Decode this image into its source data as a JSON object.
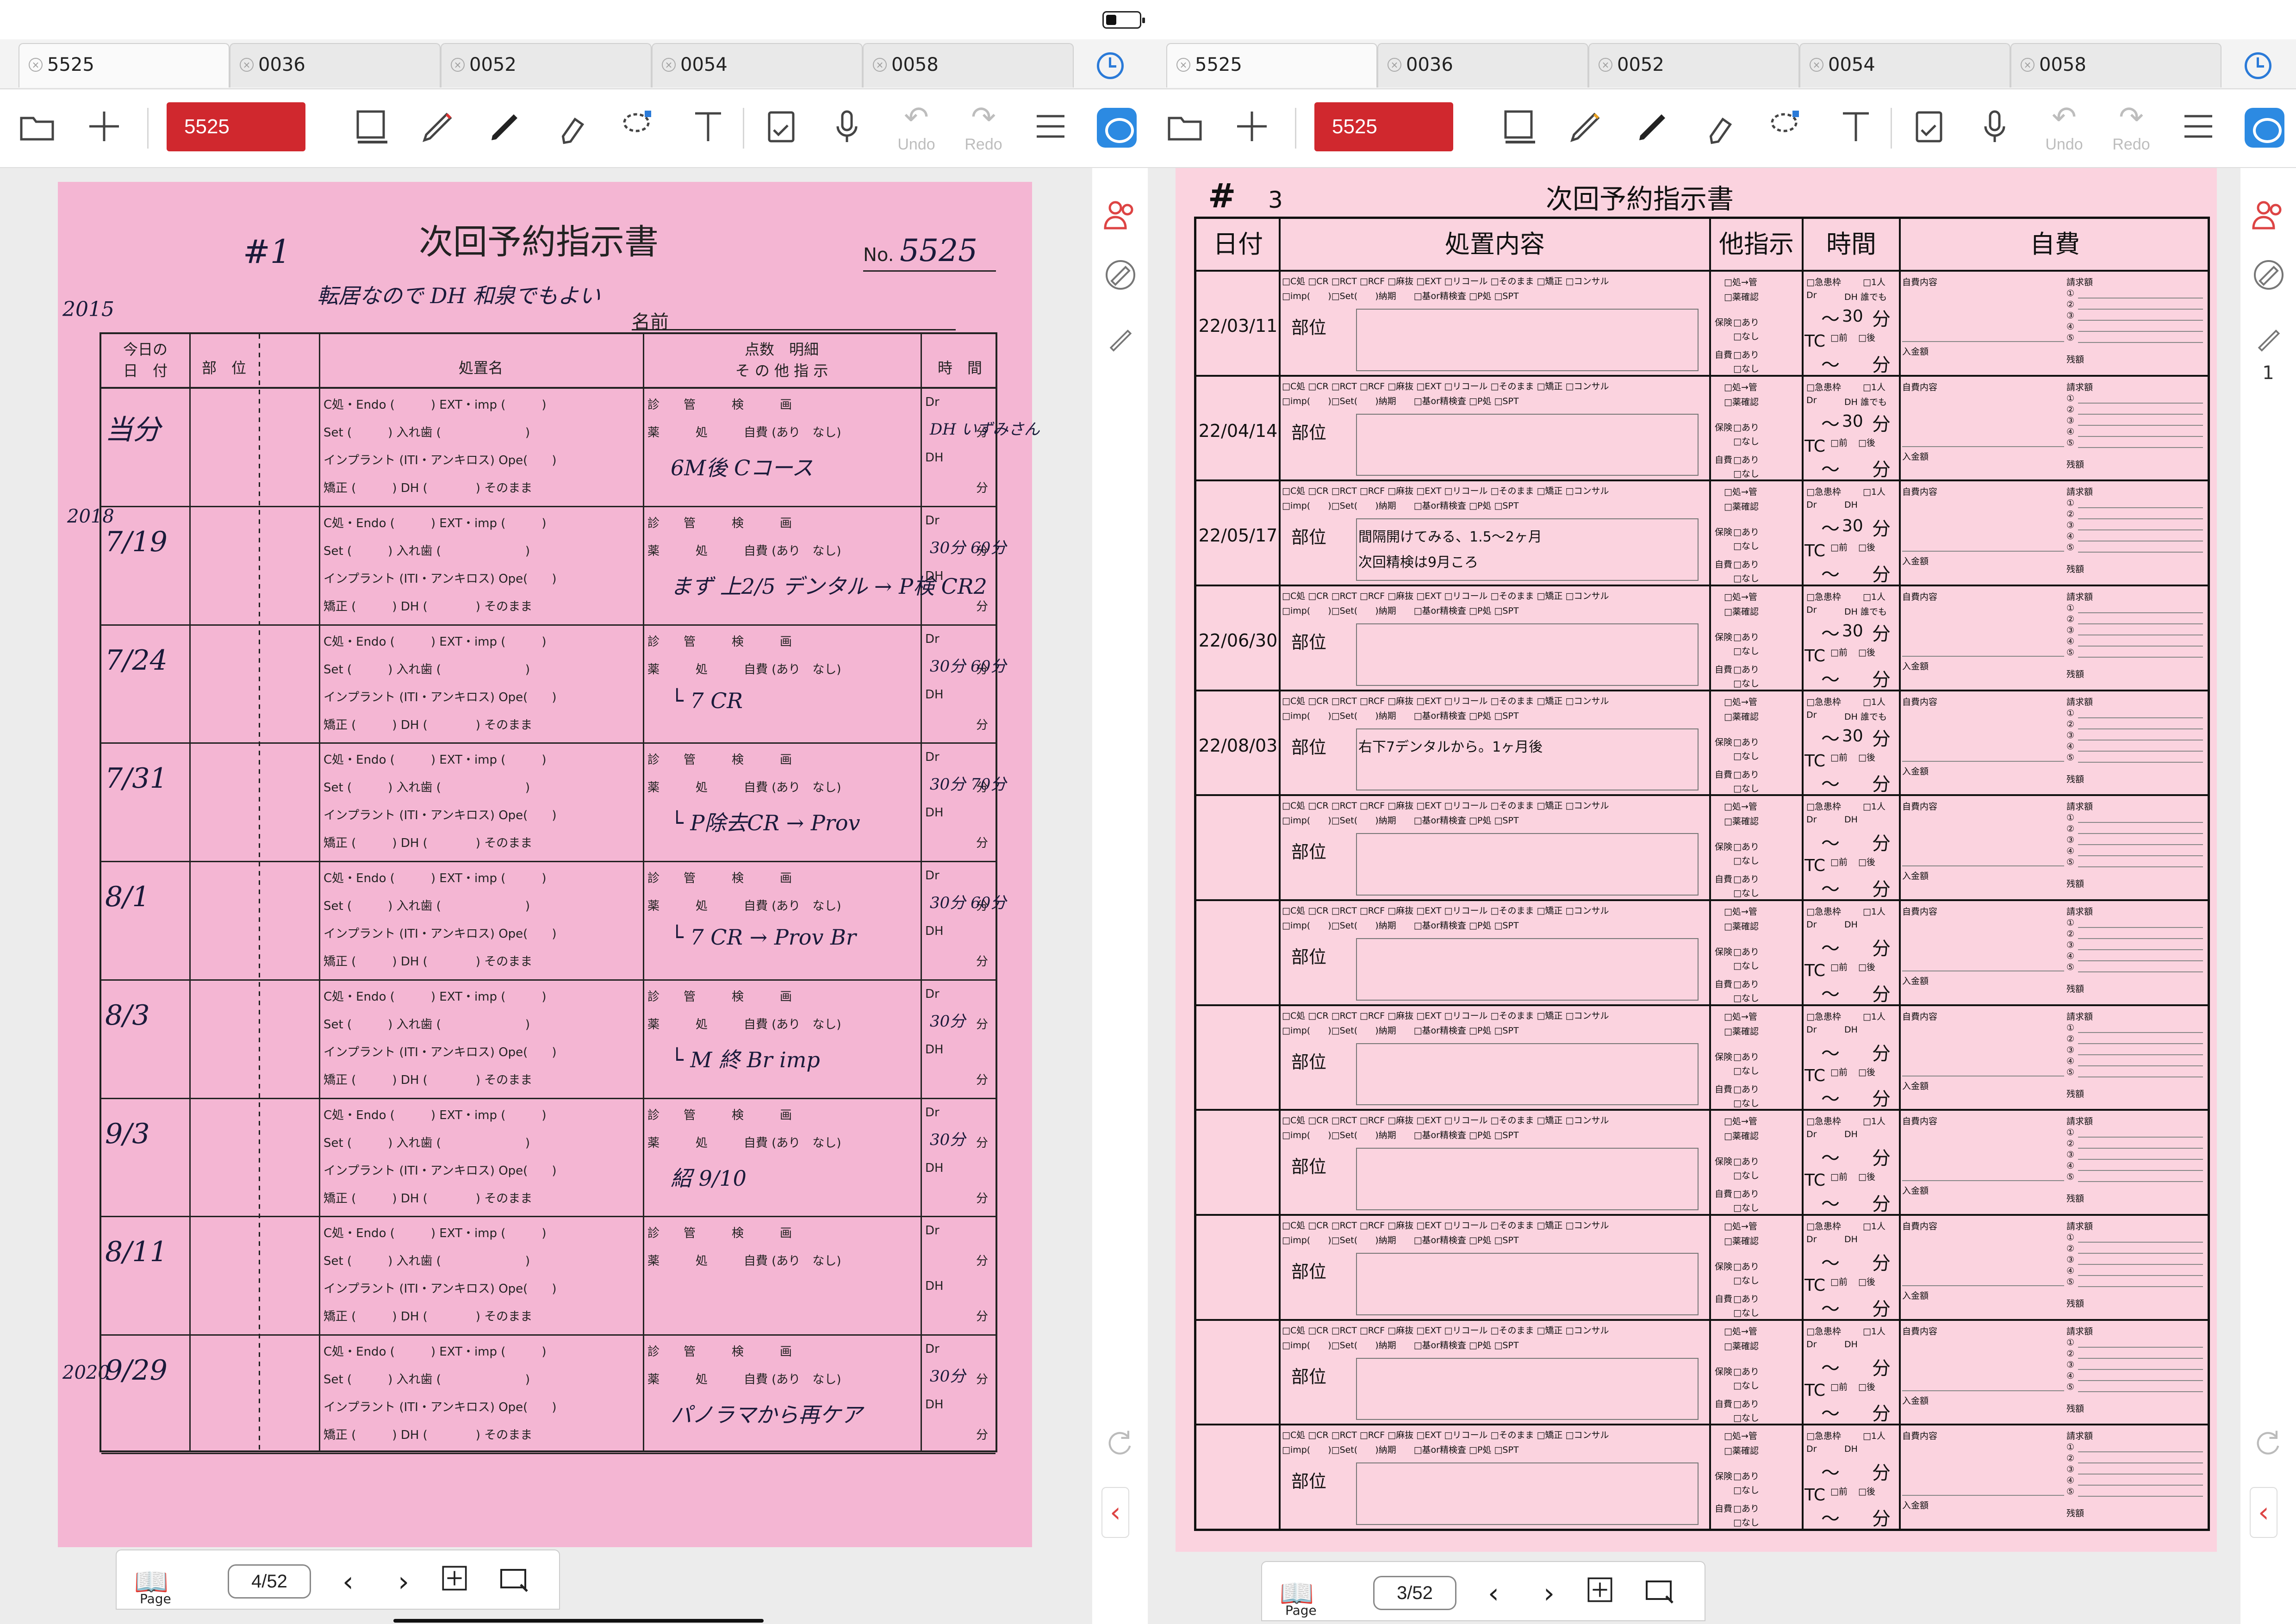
{
  "left_pane": {
    "tabs": [
      "5525",
      "0036",
      "0052",
      "0054",
      "0058"
    ],
    "toolbar": {
      "patient_name": "5525",
      "undo_label": "Undo",
      "redo_label": "Redo"
    },
    "side": {
      "page_count": ""
    },
    "bottom": {
      "page_indicator": "4/52",
      "page_label": "Page"
    },
    "form": {
      "title": "次回予約指示書",
      "no_label": "No.",
      "no_value": "5525",
      "hash_note": "#1",
      "year_note_1": "2015",
      "top_note": "転居なので DH 和泉でもよい",
      "name_label": "名前",
      "headers": {
        "date_line1": "今日の",
        "date_line2": "日　付",
        "area": "部　位",
        "treatment": "処置名",
        "points_line1": "点数　明細",
        "points_line2": "そ の 他 指 示",
        "time": "時　間"
      },
      "template_lines": {
        "l1": "C処・Endo (　　　) EXT・imp (　　　)",
        "l2": "Set (　　　) 入れ歯 (　　　　　　　)",
        "l3": "インプラント (ITI・アンキロス) Ope(　　)",
        "l4": "矯正 (　　　) DH (　　　　) そのまま",
        "r1": "診　　管　　　検　　　画",
        "r2": "薬　　　処　　　自費 (あり　なし)",
        "time_dr": "Dr",
        "time_dh": "DH",
        "time_min": "分"
      },
      "rows": [
        {
          "date": "当分",
          "note": "6M後 Cコース",
          "time": "DH いずみさん"
        },
        {
          "date": "7/19",
          "note": "まず 上2/5 デンタル → P検 CR2",
          "time": "30分 60分"
        },
        {
          "date": "7/24",
          "note": "└ 7 CR",
          "time": "30分 60分"
        },
        {
          "date": "7/31",
          "note": "└ P除去CR → Prov",
          "time": "30分 70分"
        },
        {
          "date": "8/1",
          "note": "└ 7 CR → Prov Br",
          "time": "30分 60分"
        },
        {
          "date": "8/3",
          "note": "└ M 終 Br imp",
          "time": "30分"
        },
        {
          "date": "9/3",
          "note": "紹 9/10",
          "time": "30分"
        },
        {
          "date": "8/11",
          "note": "",
          "time": ""
        },
        {
          "date": "9/29",
          "note": "パノラマから再ケア",
          "time": "30分"
        }
      ],
      "year_notes": [
        "2018",
        "2020"
      ]
    }
  },
  "right_pane": {
    "tabs": [
      "5525",
      "0036",
      "0052",
      "0054",
      "0058"
    ],
    "toolbar": {
      "patient_name": "5525",
      "undo_label": "Undo",
      "redo_label": "Redo"
    },
    "side": {
      "page_count": "1"
    },
    "bottom": {
      "page_indicator": "3/52",
      "page_label": "Page"
    },
    "form": {
      "hash": "#",
      "number": "3",
      "title": "次回予約指示書",
      "headers": {
        "date": "日付",
        "treatment": "処置内容",
        "other": "他指示",
        "time": "時間",
        "self_pay": "自費"
      },
      "check_line1": "□C処 □CR □RCT □RCF □麻抜 □EXT □リコール □そのまま □矯正 □コンサル",
      "check_line2": "□imp(　　)□Set(　　)納期　　□基or精検査 □P処 □SPT",
      "area_label": "部位",
      "other_items": [
        "□処→管",
        "□薬確認",
        "保険",
        "□あり",
        "□なし",
        "自費",
        "□あり",
        "□なし"
      ],
      "time_items": {
        "emergency": "□急患枠",
        "one_person": "□1人",
        "dr": "Dr",
        "dh": "DH",
        "tilde": "～",
        "min": "分",
        "tc": "TC",
        "before": "□前",
        "after": "□後"
      },
      "self_pay_items": {
        "content": "自費内容",
        "bill": "請求額",
        "deposit": "入金額",
        "balance": "残額",
        "nums": [
          "①",
          "②",
          "③",
          "④",
          "⑤"
        ]
      },
      "rows": [
        {
          "date": "22/03/11",
          "note1": "",
          "note2": "",
          "tmin": "30",
          "dh_note": "DH 誰でも"
        },
        {
          "date": "22/04/14",
          "note1": "",
          "note2": "",
          "tmin": "30",
          "dh_note": "DH 誰でも"
        },
        {
          "date": "22/05/17",
          "note1": "間隔開けてみる、1.5～2ヶ月",
          "note2": "次回精検は9月ころ",
          "tmin": "30",
          "dh_note": "DH"
        },
        {
          "date": "22/06/30",
          "note1": "",
          "note2": "",
          "tmin": "30",
          "dh_note": "DH 誰でも"
        },
        {
          "date": "22/08/03",
          "note1": "右下7デンタルから。1ヶ月後",
          "note2": "",
          "tmin": "30",
          "dh_note": "DH 誰でも"
        },
        {
          "date": "",
          "note1": "",
          "note2": "",
          "tmin": "",
          "dh_note": "DH"
        },
        {
          "date": "",
          "note1": "",
          "note2": "",
          "tmin": "",
          "dh_note": "DH"
        },
        {
          "date": "",
          "note1": "",
          "note2": "",
          "tmin": "",
          "dh_note": "DH"
        },
        {
          "date": "",
          "note1": "",
          "note2": "",
          "tmin": "",
          "dh_note": "DH"
        },
        {
          "date": "",
          "note1": "",
          "note2": "",
          "tmin": "",
          "dh_note": "DH"
        },
        {
          "date": "",
          "note1": "",
          "note2": "",
          "tmin": "",
          "dh_note": "DH"
        },
        {
          "date": "",
          "note1": "",
          "note2": "",
          "tmin": "",
          "dh_note": "DH"
        }
      ]
    }
  }
}
